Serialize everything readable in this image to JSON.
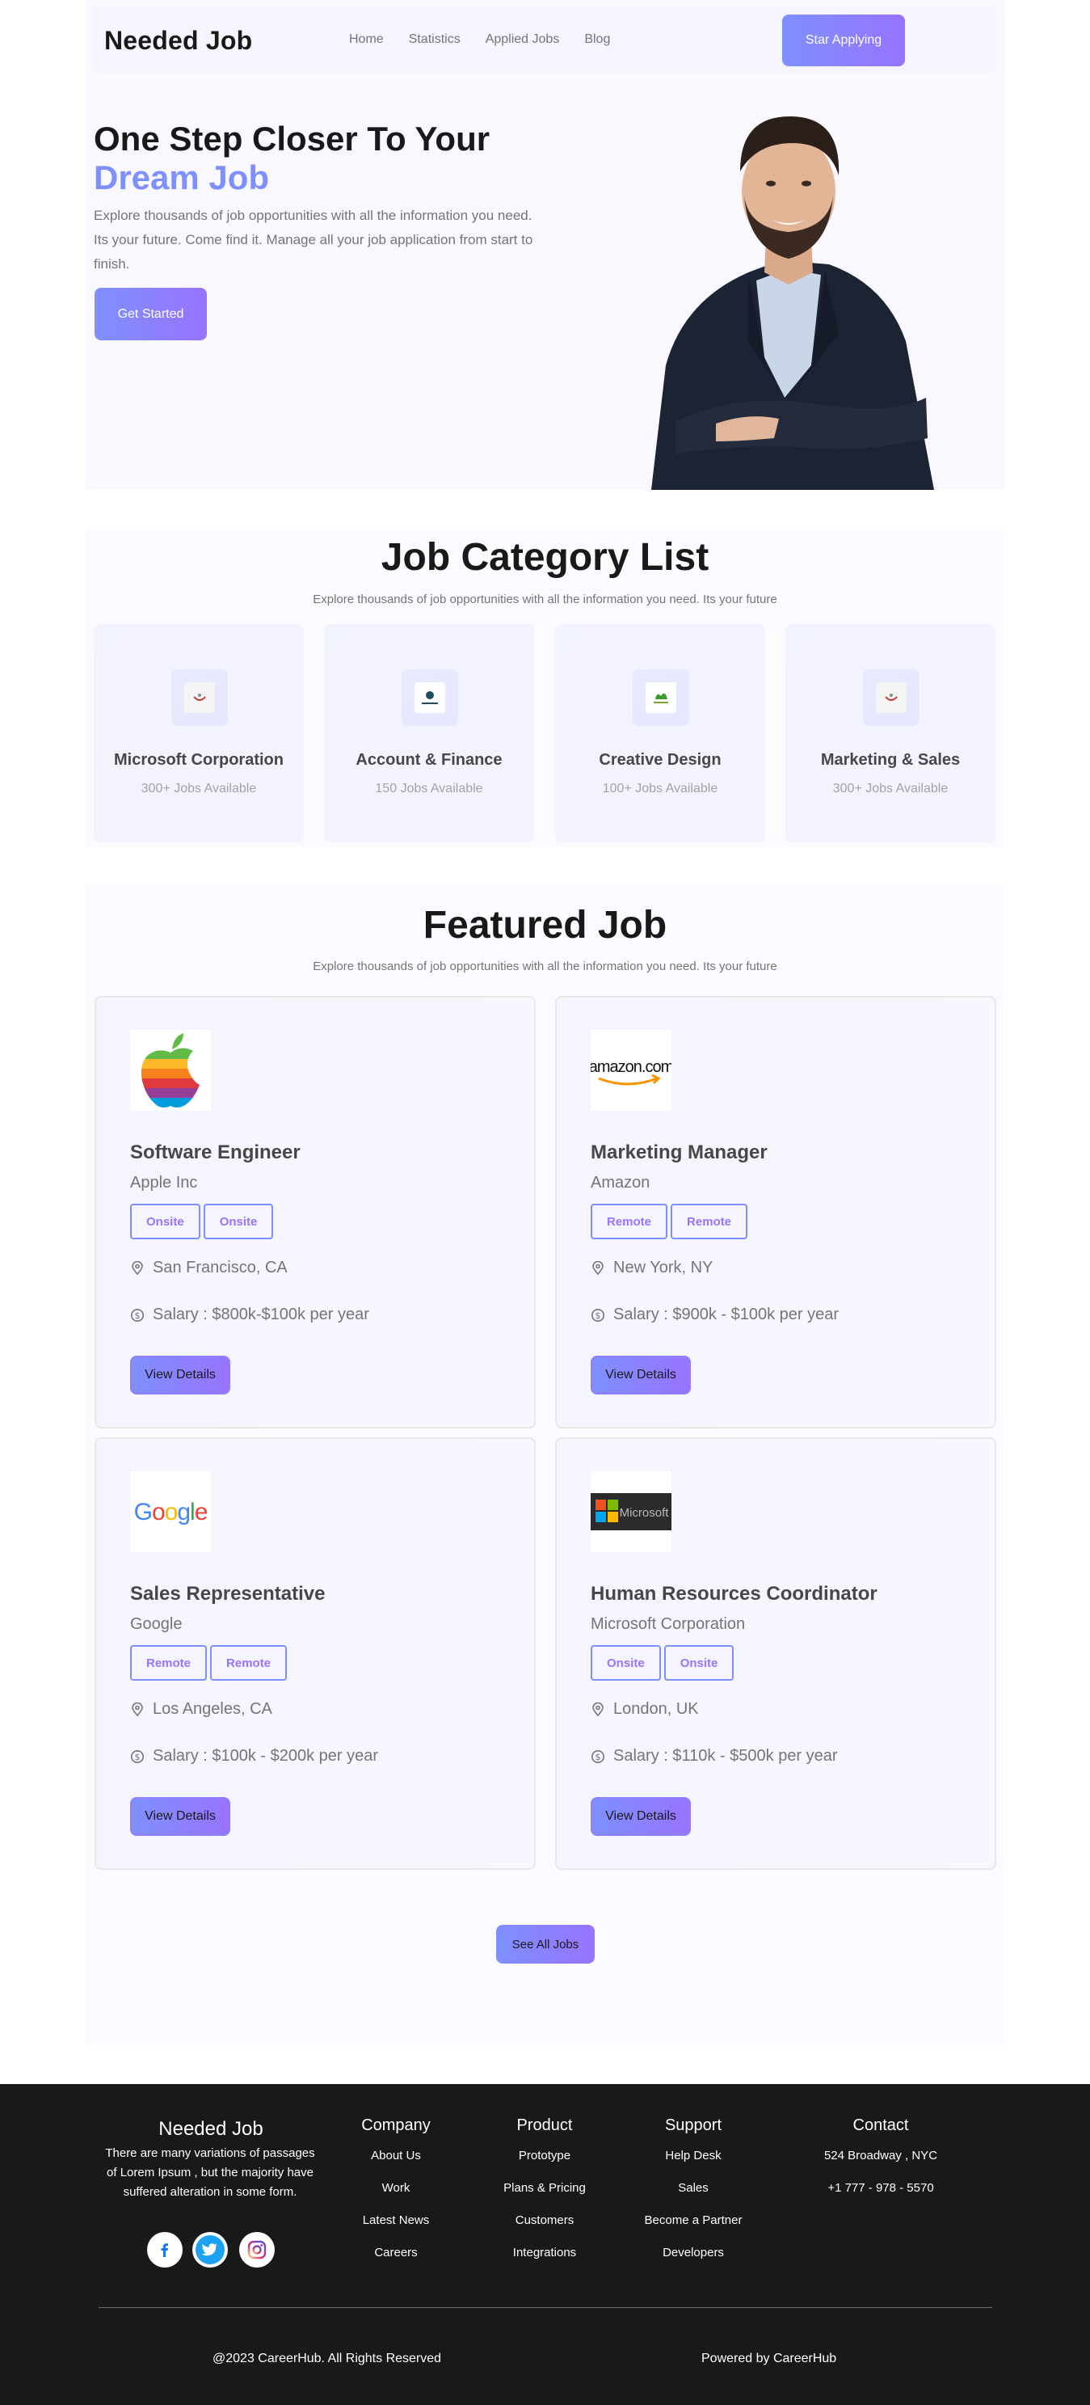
{
  "header": {
    "brand": "Needed Job",
    "nav": [
      "Home",
      "Statistics",
      "Applied Jobs",
      "Blog"
    ],
    "cta": "Star Applying"
  },
  "hero": {
    "title_line1": "One Step Closer To Your",
    "title_accent": "Dream Job",
    "description": "Explore thousands of job opportunities with all the information you need. Its your future. Come find it. Manage all your job application from start to finish.",
    "button": "Get Started"
  },
  "categories": {
    "title": "Job Category List",
    "subtitle": "Explore thousands of job opportunities with all the information you need. Its your future",
    "items": [
      {
        "name": "Microsoft Corporation",
        "count": "300+ Jobs Available",
        "icon": "category-logo-icon"
      },
      {
        "name": "Account & Finance",
        "count": "150 Jobs Available",
        "icon": "finance-logo-icon"
      },
      {
        "name": "Creative Design",
        "count": "100+ Jobs Available",
        "icon": "creative-logo-icon"
      },
      {
        "name": "Marketing & Sales",
        "count": "300+ Jobs Available",
        "icon": "marketing-logo-icon"
      }
    ]
  },
  "featured": {
    "title": "Featured Job",
    "subtitle": "Explore thousands of job opportunities with all the information you need. Its your future",
    "jobs": [
      {
        "title": "Software Engineer",
        "company": "Apple Inc",
        "tags": [
          "Onsite",
          "Onsite"
        ],
        "location": "San Francisco, CA",
        "salary": "Salary : $800k-$100k per year",
        "button": "View Details",
        "logo": "apple-logo"
      },
      {
        "title": "Marketing Manager",
        "company": "Amazon",
        "tags": [
          "Remote",
          "Remote"
        ],
        "location": "New York, NY",
        "salary": "Salary : $900k - $100k per year",
        "button": "View Details",
        "logo": "amazon-logo"
      },
      {
        "title": "Sales Representative",
        "company": "Google",
        "tags": [
          "Remote",
          "Remote"
        ],
        "location": "Los Angeles, CA",
        "salary": "Salary : $100k - $200k per year",
        "button": "View Details",
        "logo": "google-logo"
      },
      {
        "title": "Human Resources Coordinator",
        "company": "Microsoft Corporation",
        "tags": [
          "Onsite",
          "Onsite"
        ],
        "location": "London, UK",
        "salary": "Salary : $110k - $500k per year",
        "button": "View Details",
        "logo": "microsoft-logo"
      }
    ],
    "see_all": "See All Jobs",
    "logo_text": {
      "amazon": "amazon.com",
      "google": "Google",
      "microsoft": "Microsoft"
    }
  },
  "footer": {
    "brand": "Needed Job",
    "description": "There are many variations of passages of Lorem Ipsum , but the majority have suffered alteration in some form.",
    "columns": [
      {
        "title": "Company",
        "links": [
          "About Us",
          "Work",
          "Latest News",
          "Careers"
        ]
      },
      {
        "title": "Product",
        "links": [
          "Prototype",
          "Plans & Pricing",
          "Customers",
          "Integrations"
        ]
      },
      {
        "title": "Support",
        "links": [
          "Help Desk",
          "Sales",
          "Become a Partner",
          "Developers"
        ]
      },
      {
        "title": "Contact",
        "links": [
          "524 Broadway , NYC",
          "+1 777 - 978 - 5570"
        ]
      }
    ],
    "copyright": "@2023 CareerHub. All Rights Reserved",
    "powered": "Powered by CareerHub"
  },
  "colors": {
    "accent_start": "#7e90fe",
    "accent_end": "#9873ff",
    "footer_bg": "#1a1919",
    "heading": "#1a1919",
    "muted": "#757575"
  }
}
